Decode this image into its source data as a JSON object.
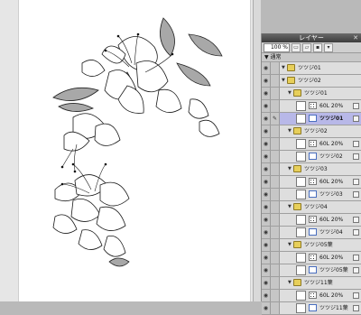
{
  "panel": {
    "title": "レイヤー",
    "close_glyph": "✕",
    "opacity": "100 %",
    "mode": "▼ 通常"
  },
  "layers": [
    {
      "label": "ツツジ01",
      "type": "folder",
      "indent": 1,
      "selected": false
    },
    {
      "label": "ツツジ02",
      "type": "folder",
      "indent": 1,
      "selected": false
    },
    {
      "label": "ツツジ01",
      "type": "folder",
      "indent": 2,
      "selected": false
    },
    {
      "label": "60L 20%",
      "type": "tone",
      "indent": 3,
      "selected": false
    },
    {
      "label": "ツツジ01",
      "type": "vector",
      "indent": 3,
      "selected": true
    },
    {
      "label": "ツツジ02",
      "type": "folder",
      "indent": 2,
      "selected": false
    },
    {
      "label": "60L 20%",
      "type": "tone",
      "indent": 3,
      "selected": false
    },
    {
      "label": "ツツジ02",
      "type": "vector",
      "indent": 3,
      "selected": false
    },
    {
      "label": "ツツジ03",
      "type": "folder",
      "indent": 2,
      "selected": false
    },
    {
      "label": "60L 20%",
      "type": "tone",
      "indent": 3,
      "selected": false
    },
    {
      "label": "ツツジ03",
      "type": "vector",
      "indent": 3,
      "selected": false
    },
    {
      "label": "ツツジ04",
      "type": "folder",
      "indent": 2,
      "selected": false
    },
    {
      "label": "60L 20%",
      "type": "tone",
      "indent": 3,
      "selected": false
    },
    {
      "label": "ツツジ04",
      "type": "vector",
      "indent": 3,
      "selected": false
    },
    {
      "label": "ツツジ05葉",
      "type": "folder",
      "indent": 2,
      "selected": false
    },
    {
      "label": "60L 20%",
      "type": "tone",
      "indent": 3,
      "selected": false
    },
    {
      "label": "ツツジ05葉",
      "type": "vector",
      "indent": 3,
      "selected": false
    },
    {
      "label": "ツツジ11葉",
      "type": "folder",
      "indent": 2,
      "selected": false
    },
    {
      "label": "60L 20%",
      "type": "tone",
      "indent": 3,
      "selected": false
    },
    {
      "label": "ツツジ11葉",
      "type": "vector",
      "indent": 3,
      "selected": false
    }
  ],
  "colors": {
    "selected_row": "#b8b8e8",
    "leaf_fill": "#a9a9a9",
    "folder": "#e7cf5a"
  }
}
